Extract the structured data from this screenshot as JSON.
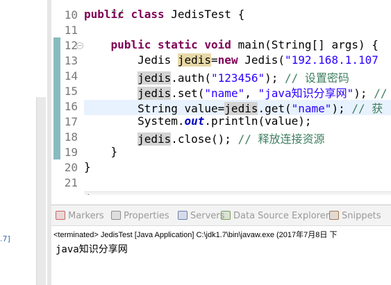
{
  "editor": {
    "partial_top": "*/",
    "lines": [
      {
        "no": "10",
        "tokens": [
          {
            "t": "public ",
            "c": "kw"
          },
          {
            "t": "class ",
            "c": "kw"
          },
          {
            "t": "JedisTest {",
            "c": ""
          }
        ]
      },
      {
        "no": "11",
        "tokens": []
      },
      {
        "no": "12",
        "tokens": [
          {
            "t": "    ",
            "c": ""
          },
          {
            "t": "public ",
            "c": "kw"
          },
          {
            "t": "static ",
            "c": "kw"
          },
          {
            "t": "void ",
            "c": "kw"
          },
          {
            "t": "main(String[] ",
            "c": ""
          },
          {
            "t": "args",
            "c": ""
          },
          {
            "t": ") {",
            "c": ""
          }
        ]
      },
      {
        "no": "13",
        "tokens": [
          {
            "t": "        Jedis ",
            "c": ""
          },
          {
            "t": "jedis",
            "c": "var w"
          },
          {
            "t": "=",
            "c": ""
          },
          {
            "t": "new ",
            "c": "kw"
          },
          {
            "t": "Jedis(",
            "c": ""
          },
          {
            "t": "\"192.168.1.107",
            "c": "str"
          }
        ]
      },
      {
        "no": "14",
        "tokens": [
          {
            "t": "        ",
            "c": ""
          },
          {
            "t": "jedis",
            "c": "var"
          },
          {
            "t": ".auth(",
            "c": ""
          },
          {
            "t": "\"123456\"",
            "c": "str"
          },
          {
            "t": "); ",
            "c": ""
          },
          {
            "t": "// 设置密码",
            "c": "cm"
          }
        ]
      },
      {
        "no": "15",
        "tokens": [
          {
            "t": "        ",
            "c": ""
          },
          {
            "t": "jedis",
            "c": "var"
          },
          {
            "t": ".set(",
            "c": ""
          },
          {
            "t": "\"name\"",
            "c": "str"
          },
          {
            "t": ", ",
            "c": ""
          },
          {
            "t": "\"java知识分享网\"",
            "c": "str"
          },
          {
            "t": "); ",
            "c": ""
          },
          {
            "t": "//",
            "c": "cm"
          }
        ]
      },
      {
        "no": "16",
        "tokens": [
          {
            "t": "        String value=",
            "c": ""
          },
          {
            "t": "jedis",
            "c": "var"
          },
          {
            "t": ".get(",
            "c": ""
          },
          {
            "t": "\"name\"",
            "c": "str"
          },
          {
            "t": "); ",
            "c": ""
          },
          {
            "t": "// 获",
            "c": "cm"
          }
        ]
      },
      {
        "no": "17",
        "tokens": [
          {
            "t": "        System.",
            "c": ""
          },
          {
            "t": "out",
            "c": "fld"
          },
          {
            "t": ".println(value);",
            "c": ""
          }
        ]
      },
      {
        "no": "18",
        "tokens": [
          {
            "t": "        ",
            "c": ""
          },
          {
            "t": "jedis",
            "c": "var"
          },
          {
            "t": ".close(); ",
            "c": ""
          },
          {
            "t": "// 释放连接资源",
            "c": "cm"
          }
        ]
      },
      {
        "no": "19",
        "tokens": [
          {
            "t": "    }",
            "c": ""
          }
        ]
      },
      {
        "no": "20",
        "tokens": [
          {
            "t": "}",
            "c": ""
          }
        ]
      },
      {
        "no": "21",
        "tokens": []
      }
    ]
  },
  "tabs": [
    {
      "label": "Markers",
      "icon": "markers-icon",
      "color": "#c86464"
    },
    {
      "label": "Properties",
      "icon": "properties-icon",
      "color": "#8c8c8c"
    },
    {
      "label": "Servers",
      "icon": "servers-icon",
      "color": "#6a7fb4"
    },
    {
      "label": "Data Source Explorer",
      "icon": "data-source-icon",
      "color": "#7aa05a"
    },
    {
      "label": "Snippets",
      "icon": "snippets-icon",
      "color": "#a07850"
    }
  ],
  "console": {
    "status": "<terminated> JedisTest [Java Application] C:\\jdk1.7\\bin\\javaw.exe (2017年7月8日 下",
    "output": "java知识分享网"
  },
  "left_fragment": ".7]",
  "colors": {
    "keyword": "#7f0055",
    "string": "#2a00ff",
    "comment": "#3f7f5f",
    "current_line": "#e8f2fe"
  }
}
